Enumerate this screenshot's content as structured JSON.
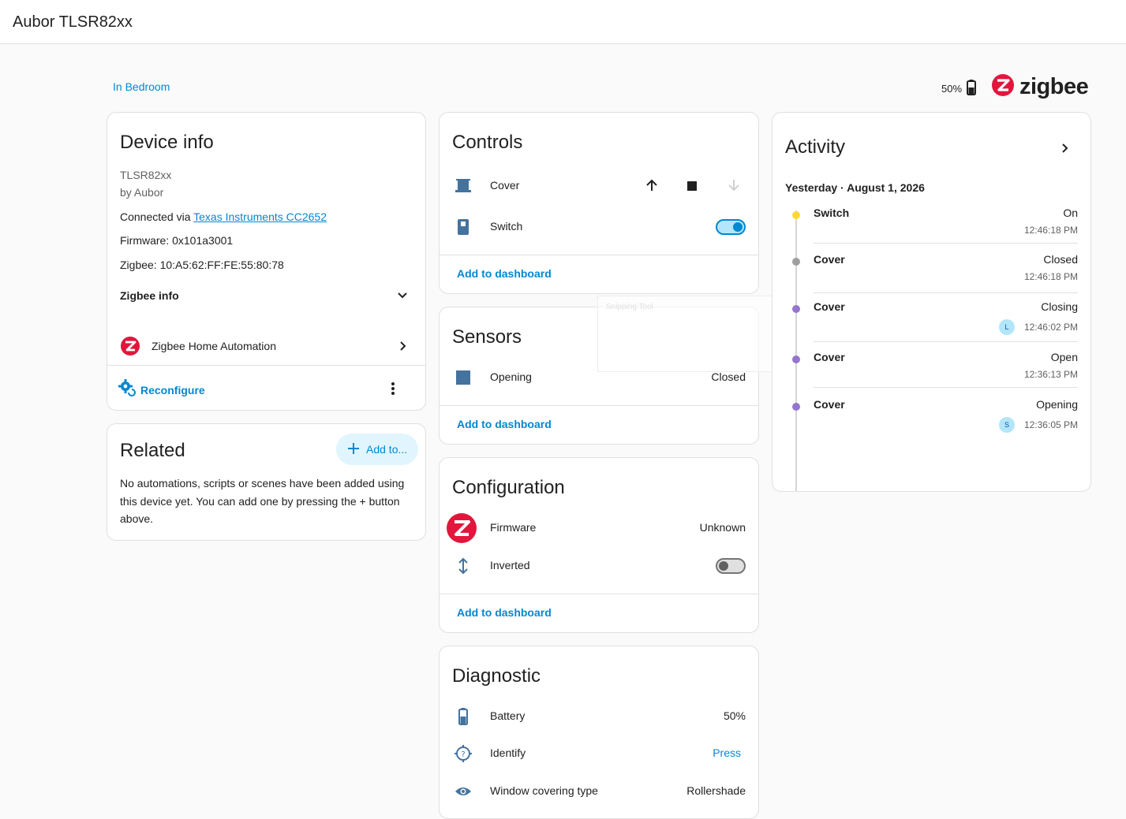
{
  "header": {
    "title": "Aubor TLSR82xx"
  },
  "area_link": "In Bedroom",
  "battery_top": {
    "value": "50%"
  },
  "brand": {
    "word": "zigbee",
    "accent": "#e2163c"
  },
  "device_info": {
    "title": "Device info",
    "model": "TLSR82xx",
    "manufacturer": "by Aubor",
    "connected_prefix": "Connected via ",
    "connected_link": "Texas Instruments CC2652",
    "firmware": "Firmware: 0x101a3001",
    "zigbee": "Zigbee: 10:A5:62:FF:FE:55:80:78",
    "zigbee_info": "Zigbee info",
    "integration": "Zigbee Home Automation",
    "reconfigure": "Reconfigure"
  },
  "related": {
    "title": "Related",
    "add_button": "Add to...",
    "text": "No automations, scripts or scenes have been added using this device yet. You can add one by pressing the + button above."
  },
  "controls": {
    "title": "Controls",
    "rows": [
      {
        "label": "Cover",
        "icon": "blind-icon"
      },
      {
        "label": "Switch",
        "icon": "switch-icon",
        "state": "on"
      }
    ],
    "add_to_dashboard": "Add to dashboard"
  },
  "sensors": {
    "title": "Sensors",
    "rows": [
      {
        "label": "Opening",
        "value": "Closed",
        "icon": "square-icon"
      }
    ],
    "add_to_dashboard": "Add to dashboard"
  },
  "configuration": {
    "title": "Configuration",
    "rows": [
      {
        "label": "Firmware",
        "value": "Unknown",
        "icon": "zigbee-icon"
      },
      {
        "label": "Inverted",
        "icon": "arrow-up-down-icon",
        "state": "off"
      }
    ],
    "add_to_dashboard": "Add to dashboard"
  },
  "diagnostic": {
    "title": "Diagnostic",
    "rows": [
      {
        "label": "Battery",
        "value": "50%",
        "icon": "battery-icon"
      },
      {
        "label": "Identify",
        "value": "Press",
        "icon": "crosshairs-question-icon"
      },
      {
        "label": "Window covering type",
        "value": "Rollershade",
        "icon": "eye-icon"
      }
    ]
  },
  "activity": {
    "title": "Activity",
    "date": "Yesterday · August 1, 2026",
    "entries": [
      {
        "name": "Switch",
        "state": "On",
        "time": "12:46:18 PM",
        "dot": "#fdd835"
      },
      {
        "name": "Cover",
        "state": "Closed",
        "time": "12:46:18 PM",
        "dot": "#9e9e9e"
      },
      {
        "name": "Cover",
        "state": "Closing",
        "time": "12:46:02 PM",
        "dot": "#9575cd",
        "avatar": "L"
      },
      {
        "name": "Cover",
        "state": "Open",
        "time": "12:36:13 PM",
        "dot": "#9575cd"
      },
      {
        "name": "Cover",
        "state": "Opening",
        "time": "12:36:05 PM",
        "dot": "#9575cd",
        "avatar": "S"
      }
    ]
  },
  "overlay": {
    "text": "Snipping Tool"
  }
}
